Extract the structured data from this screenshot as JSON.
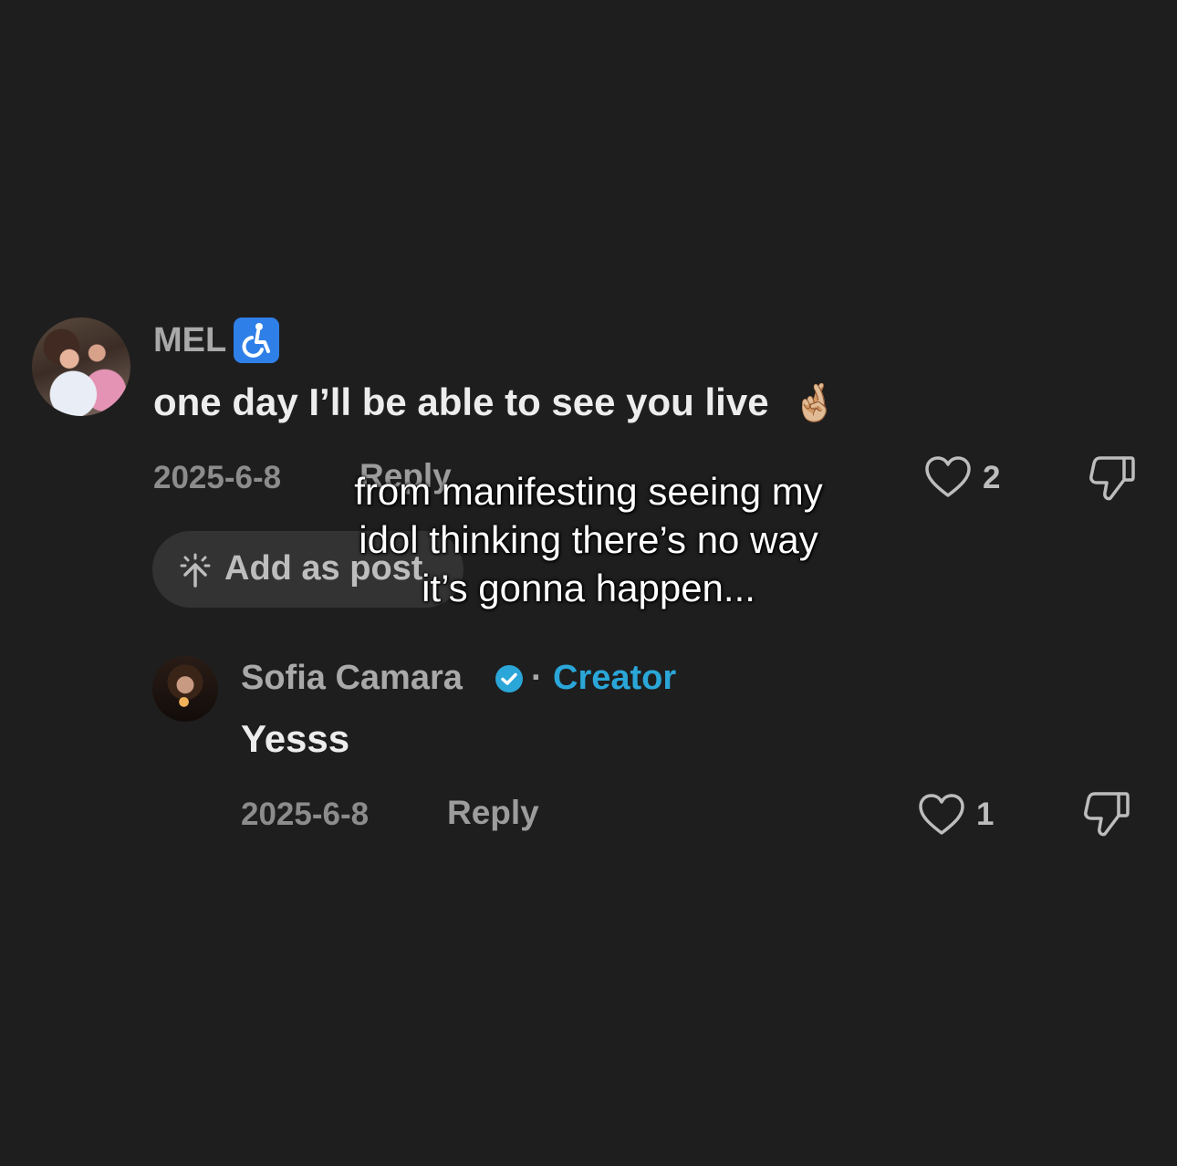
{
  "comment": {
    "username": "MEL",
    "username_badge_icon": "wheelchair-icon",
    "text": "one day I’ll be able to see you live",
    "text_emoji": "🤞🏼",
    "date": "2025-6-8",
    "reply_label": "Reply",
    "like_count": "2",
    "add_as_post_label": "Add as post"
  },
  "reply": {
    "username": "Sofia Camara",
    "separator": "·",
    "creator_label": "Creator",
    "text": "Yesss",
    "date": "2025-6-8",
    "reply_label": "Reply",
    "like_count": "1"
  },
  "caption": {
    "lines": [
      "from manifesting seeing my",
      "idol thinking there’s no way",
      "it’s gonna happen..."
    ]
  },
  "colors": {
    "background": "#1e1e1e",
    "creator_accent": "#2aa6d8",
    "verified_badge": "#2aa6d8",
    "wheelchair_badge": "#2f7fe8"
  }
}
